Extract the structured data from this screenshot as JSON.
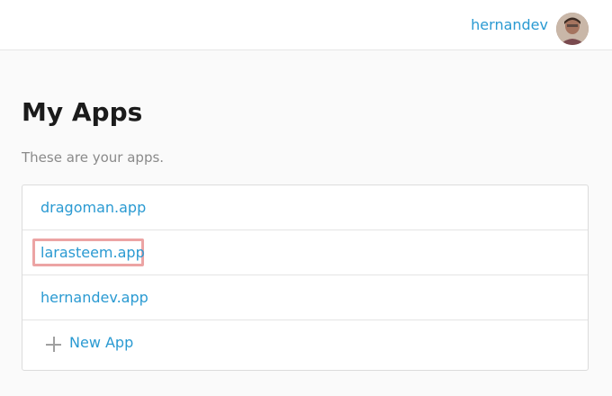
{
  "header": {
    "username": "hernandev",
    "avatar_icon": "user-avatar"
  },
  "main": {
    "title": "My Apps",
    "subtitle": "These are your apps.",
    "apps": [
      {
        "name": "dragoman.app"
      },
      {
        "name": "larasteem.app",
        "highlighted": true
      },
      {
        "name": "hernandev.app"
      }
    ],
    "new_app_label": "New App",
    "new_app_icon": "plus-icon"
  },
  "colors": {
    "link": "#2a9ad2",
    "highlight_border": "#eca4a4",
    "title": "#1b1b1b",
    "subtitle": "#8a8a8a"
  }
}
